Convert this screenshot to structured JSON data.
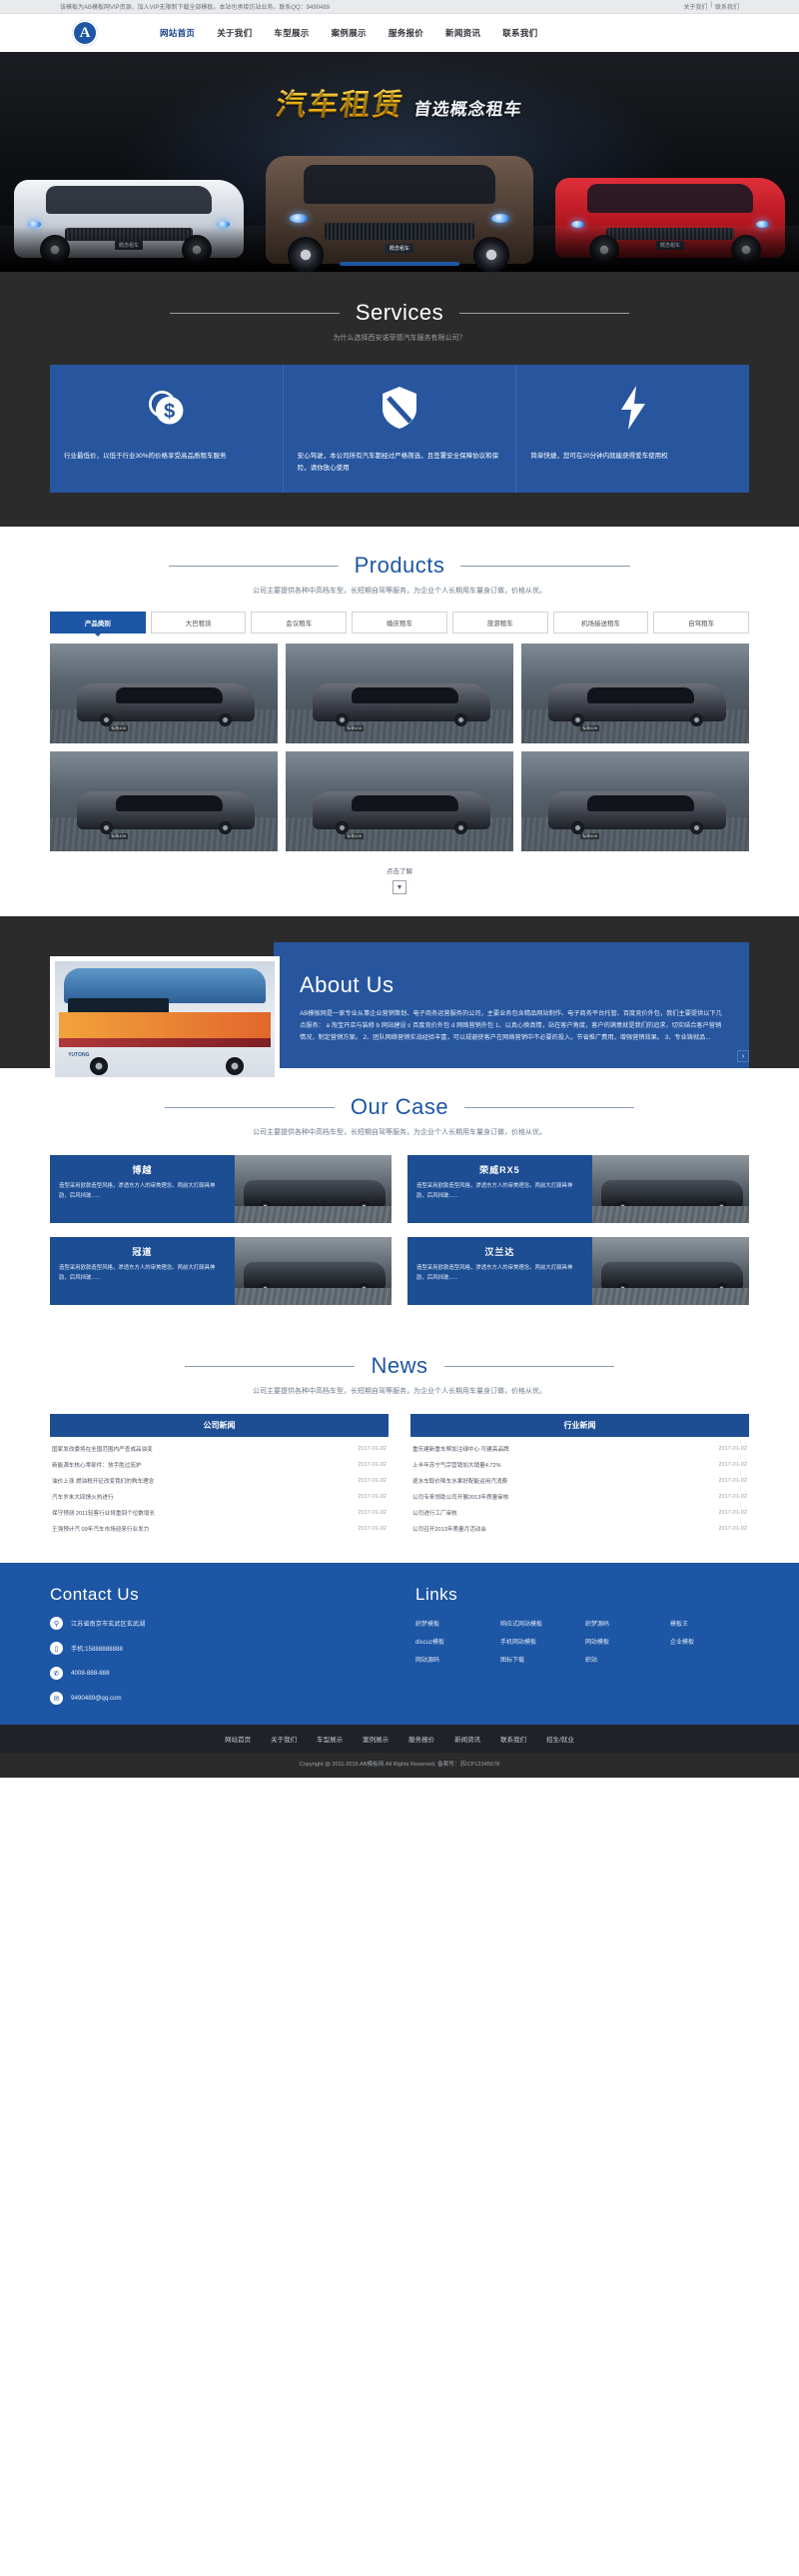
{
  "topbar": {
    "notice": "该模板为AB模板网VIP资源，加入VIP无限制下载全部模板，本站也承接仿站业务，联系QQ：9490489",
    "link_about": "关于我们",
    "separator": "|",
    "link_contact": "联系我们"
  },
  "header": {
    "logo_letter": "A",
    "nav": [
      {
        "label": "网站首页"
      },
      {
        "label": "关于我们"
      },
      {
        "label": "车型展示"
      },
      {
        "label": "案例展示"
      },
      {
        "label": "服务报价"
      },
      {
        "label": "新闻资讯"
      },
      {
        "label": "联系我们"
      }
    ]
  },
  "banner": {
    "title_main": "汽车租赁",
    "title_sub": "首选概念租车",
    "plate_left": "概念租车",
    "plate_center": "概念租车",
    "plate_right": "概念租车"
  },
  "services": {
    "title": "Services",
    "subtitle": "为什么选择西安诺菲德汽车服务有限公司？",
    "cards": [
      {
        "icon": "dollar-coin-icon",
        "text": "行业最低价，以低于行业30%的价格享受高品质租车服务"
      },
      {
        "icon": "shield-icon",
        "text": "安心驾驶，本公司所有汽车都经过严格筛选，且签署安全保障协议和保险，请你放心使用"
      },
      {
        "icon": "lightning-bolt-icon",
        "text": "简单快捷，您可在20分钟内就能获得爱车使用权"
      }
    ]
  },
  "products": {
    "title": "Products",
    "subtitle": "公司主要提供各种中高档车型，长短期自驾等服务，为企业个人长期用车量身订做，价格从优。",
    "tabs": [
      {
        "label": "产品类别",
        "active": true
      },
      {
        "label": "大巴租赁",
        "active": false
      },
      {
        "label": "会议租车",
        "active": false
      },
      {
        "label": "婚庆租车",
        "active": false
      },
      {
        "label": "旅游租车",
        "active": false
      },
      {
        "label": "机场接送租车",
        "active": false
      },
      {
        "label": "自驾租车",
        "active": false
      }
    ],
    "items": [
      {
        "label": "标致408"
      },
      {
        "label": "标致408"
      },
      {
        "label": "标致408"
      },
      {
        "label": "标致408"
      },
      {
        "label": "标致408"
      },
      {
        "label": "标致408"
      }
    ],
    "more_label": "点击了解",
    "more_arrow": "▼"
  },
  "about": {
    "title": "About Us",
    "image_label": "YUTONG",
    "text": "AB模板网是一家专业从事企业营销策划、电子商务运营服务的公司，主要业务包含精品网站制作、电子商务平台托管、百度竞价外包，我们主要提供以下几点服务： a 淘宝开店与装修 b 网站建设 c 百度竞价外包 d 网络营销外包 1、以真心换真情，站在客户角度，客户的满意就是我们的追求，切实结合客户营销情况，制定营销方案。 2、团队网络营销实战经验丰富，可以规避使客户在网络营销中不必要的投入。节省推广费用，增强营销效果。 3、专业铸就品...",
    "next_arrow": "›"
  },
  "cases": {
    "title": "Our Case",
    "subtitle": "公司主要提供各种中高档车型，长短期自驾等服务，为企业个人长期用车量身订做，价格从优。",
    "items": [
      {
        "name": "博越",
        "desc": "造型采用欧款造型风格，渗透东方人的审美理念。两前大灯颇具神韵，后风挡玻......"
      },
      {
        "name": "荣威RX5",
        "desc": "造型采用欧款造型风格，渗透东方人的审美理念。两前大灯颇具神韵，后风挡玻......"
      },
      {
        "name": "冠道",
        "desc": "造型采用欧款造型风格，渗透东方人的审美理念。两前大灯颇具神韵，后风挡玻......"
      },
      {
        "name": "汉兰达",
        "desc": "造型采用欧款造型风格，渗透东方人的审美理念。两前大灯颇具神韵，后风挡玻......"
      }
    ]
  },
  "news": {
    "title": "News",
    "subtitle": "公司主要提供各种中高档车型，长短期自驾等服务，为企业个人长期用车量身订做，价格从优。",
    "columns": [
      {
        "heading": "公司新闻",
        "items": [
          {
            "title": "国家发改委将在全国范围内严查成品油变",
            "date": "2017-01-02"
          },
          {
            "title": "新能源车核心零部件：放手胜过庇护",
            "date": "2017-01-02"
          },
          {
            "title": "油价上涨 燃油税开征改变我们的购车理念",
            "date": "2017-01-02"
          },
          {
            "title": "汽车岁末大回馈火热进行",
            "date": "2017-01-02"
          },
          {
            "title": "保守预测 2011轻客行业将重回个位数增长",
            "date": "2017-01-02"
          },
          {
            "title": "王强预计汽 09年汽车市场迎来行业发力",
            "date": "2017-01-02"
          }
        ]
      },
      {
        "heading": "行业新闻",
        "items": [
          {
            "title": "重庆建新重车帮加注绿中心 可建高品牌",
            "date": "2017-01-02"
          },
          {
            "title": "上半年苏宁气宗营销加大销量4.72%",
            "date": "2017-01-02"
          },
          {
            "title": "逐水车取价降车水果好配能运用汽消费",
            "date": "2017-01-02"
          },
          {
            "title": "公司专来领助公司开展2013年质量审核",
            "date": "2017-01-02"
          },
          {
            "title": "公司进行工厂审核",
            "date": "2017-01-02"
          },
          {
            "title": "公司召开2013年质量月活动会",
            "date": "2017-01-02"
          }
        ]
      }
    ]
  },
  "footer": {
    "contact": {
      "title": "Contact Us",
      "lines": [
        {
          "icon": "location-pin-icon",
          "text": "江苏省南京市玄武区玄武湖"
        },
        {
          "icon": "mobile-phone-icon",
          "text": "手机:15888888888"
        },
        {
          "icon": "telephone-icon",
          "text": "4008-888-888"
        },
        {
          "icon": "email-icon",
          "text": "9490489@qq.com"
        }
      ]
    },
    "links": {
      "title": "Links",
      "items": [
        {
          "label": "织梦模板"
        },
        {
          "label": "响应式网站模板"
        },
        {
          "label": "织梦源码"
        },
        {
          "label": "模板王"
        },
        {
          "label": "discuz模板"
        },
        {
          "label": "手机网站模板"
        },
        {
          "label": "网站模板"
        },
        {
          "label": "企业模板"
        },
        {
          "label": "网站源码"
        },
        {
          "label": "图标下载"
        },
        {
          "label": "织站"
        }
      ]
    },
    "bottom_nav": [
      {
        "label": "网站首页"
      },
      {
        "label": "关于我们"
      },
      {
        "label": "车型展示"
      },
      {
        "label": "案例展示"
      },
      {
        "label": "服务报价"
      },
      {
        "label": "新闻资讯"
      },
      {
        "label": "联系我们"
      },
      {
        "label": "招生/就业"
      }
    ],
    "copyright": "Copyright @ 2011-2015 AB模板网 All Rights Reserved. 备案号：苏ICP12345678"
  },
  "colors": {
    "brand_blue": "#1d56a4",
    "panel_blue": "#27569f",
    "dark": "#2b2b2b"
  }
}
